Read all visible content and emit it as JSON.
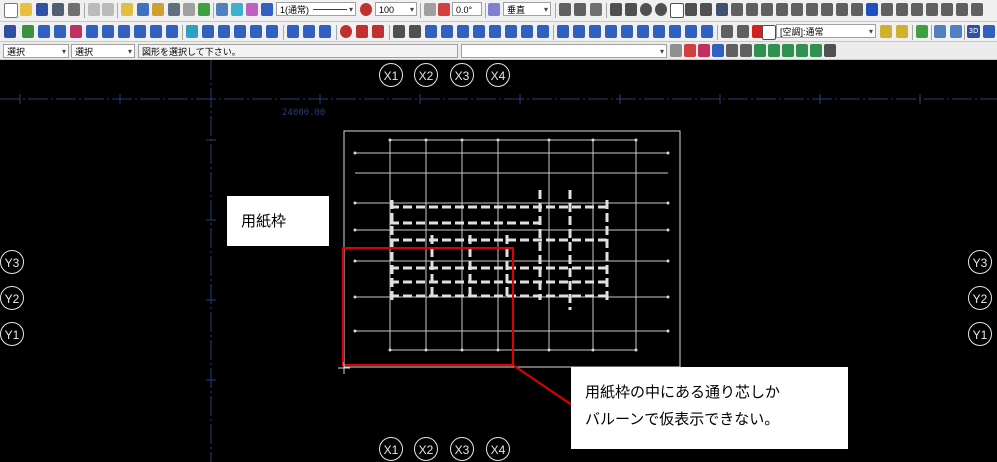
{
  "toolbar": {
    "line_style": "1(通常)",
    "percent_value": "100",
    "angle_value": "0.0°",
    "direction": "垂直",
    "mode_select_1": "選択",
    "mode_select_2": "選択",
    "status_message": "図形を選択して下さい。",
    "layer_value": "[空調]:通常",
    "threed_label": "3D"
  },
  "grid": {
    "x_labels": [
      "X1",
      "X2",
      "X3",
      "X4"
    ],
    "y_labels": [
      "Y3",
      "Y2",
      "Y1"
    ],
    "dimension_text": "24000.00"
  },
  "annotations": {
    "paper_frame_label": "用紙枠",
    "note_line1": "用紙枠の中にある通り芯しか",
    "note_line2": "バルーンで仮表示できない。"
  },
  "colors": {
    "canvas": "#000000",
    "toolbar": "#f0f0f0",
    "highlight": "#e00000",
    "drawing": "#d8d8d8",
    "grid_axis": "#2a3b7a"
  }
}
